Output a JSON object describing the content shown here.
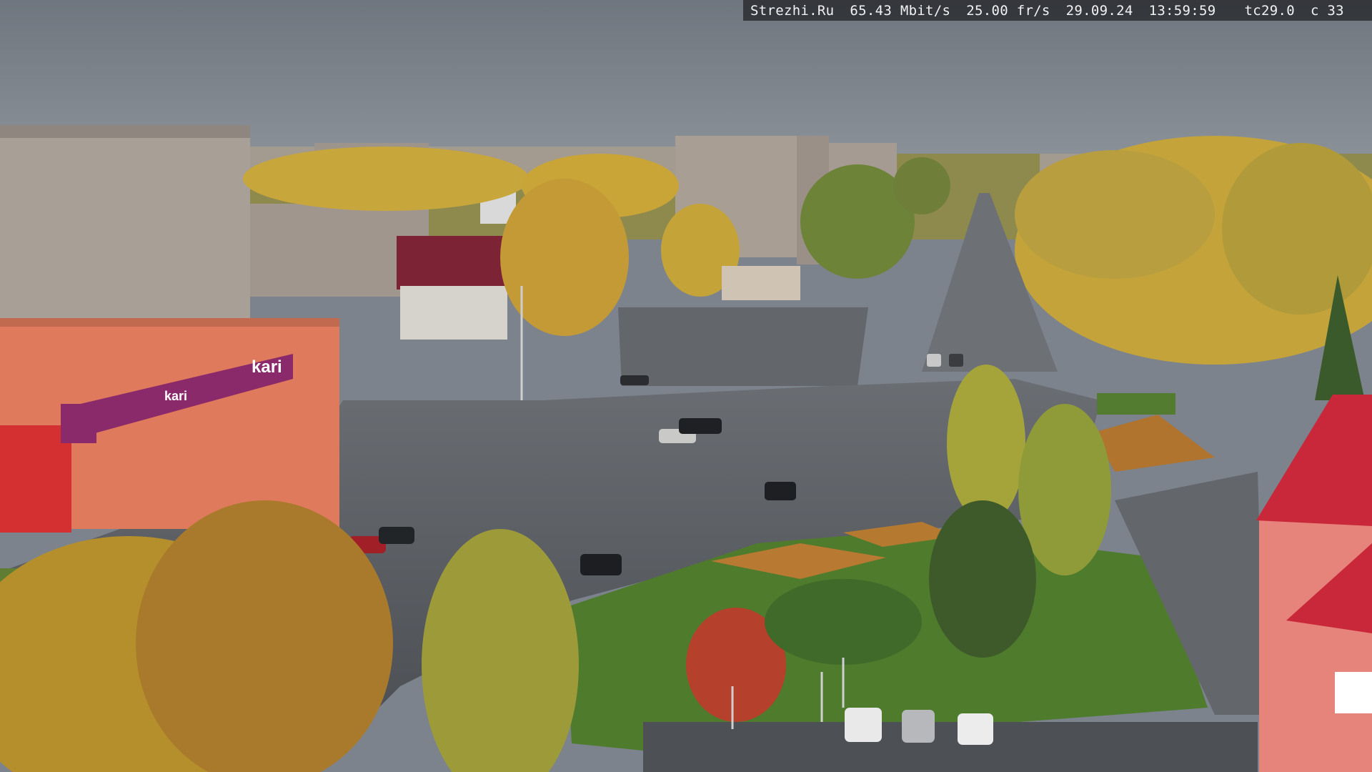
{
  "overlay": {
    "site": "Strezhi.Ru",
    "bitrate": "65.43 Mbit/s",
    "framerate": "25.00 fr/s",
    "date": "29.09.24",
    "time": "13:59:59",
    "code": "tc29.0",
    "channel": "c 33"
  },
  "signage": {
    "store_logo": "kari",
    "store_banner": "kari"
  },
  "colors": {
    "sky": "#7a8189",
    "asphalt": "#575b60",
    "grass": "#4f7a2e",
    "autumn_foliage": "#c9a236",
    "store_facade": "#e07a5c",
    "store_banner": "#8a2a6a",
    "roof_red": "#c8283a"
  }
}
